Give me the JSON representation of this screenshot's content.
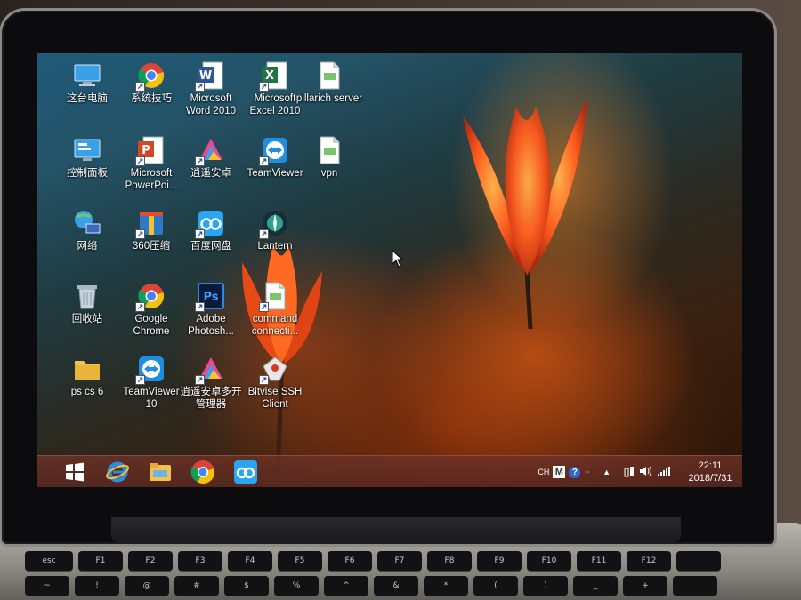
{
  "desktop_icons": [
    {
      "label": "这台电脑",
      "icon": "this-pc-icon"
    },
    {
      "label": "系统技巧",
      "icon": "chrome-shortcut-icon"
    },
    {
      "label": "Microsoft Word 2010",
      "icon": "word-icon"
    },
    {
      "label": "Microsoft Excel 2010",
      "icon": "excel-icon"
    },
    {
      "label": "pillarich server",
      "icon": "document-icon"
    },
    {
      "label": "控制面板",
      "icon": "control-panel-icon"
    },
    {
      "label": "Microsoft PowerPoi...",
      "icon": "powerpoint-icon"
    },
    {
      "label": "逍遥安卓",
      "icon": "android-emulator-icon"
    },
    {
      "label": "TeamViewer",
      "icon": "teamviewer-icon"
    },
    {
      "label": "vpn",
      "icon": "document-icon"
    },
    {
      "label": "网络",
      "icon": "network-icon"
    },
    {
      "label": "360压缩",
      "icon": "archive-icon"
    },
    {
      "label": "百度网盘",
      "icon": "baidu-cloud-icon"
    },
    {
      "label": "Lantern",
      "icon": "lantern-icon"
    },
    {
      "label": "回收站",
      "icon": "recycle-bin-icon"
    },
    {
      "label": "Google Chrome",
      "icon": "chrome-icon"
    },
    {
      "label": "Adobe Photosh...",
      "icon": "photoshop-icon"
    },
    {
      "label": "command connecti...",
      "icon": "document-icon"
    },
    {
      "label": "ps cs 6",
      "icon": "folder-icon"
    },
    {
      "label": "TeamViewer 10",
      "icon": "teamviewer-icon"
    },
    {
      "label": "逍遥安卓多开管理器",
      "icon": "android-emulator-icon"
    },
    {
      "label": "Bitvise SSH Client",
      "icon": "bitvise-icon"
    }
  ],
  "taskbar": {
    "pinned": [
      "start-icon",
      "internet-explorer-icon",
      "file-explorer-icon",
      "chrome-icon",
      "baidu-cloud-icon"
    ],
    "tray": {
      "lang": "CH",
      "ime": "M",
      "help": "?",
      "clock_time": "22:11",
      "clock_date": "2018/7/31"
    }
  },
  "keyboard": {
    "row1": [
      "esc",
      "F1",
      "F2",
      "F3",
      "F4",
      "F5",
      "F6",
      "F7",
      "F8",
      "F9",
      "F10",
      "F11",
      "F12",
      ""
    ],
    "row2": [
      "~",
      "!",
      "@",
      "#",
      "$",
      "%",
      "^",
      "&",
      "*",
      "(",
      ")",
      "_",
      "+",
      ""
    ]
  },
  "colors": {
    "taskbar": "#6e3228",
    "desktop_top": "#1e5a78",
    "tulip": "#ff5a1e"
  }
}
